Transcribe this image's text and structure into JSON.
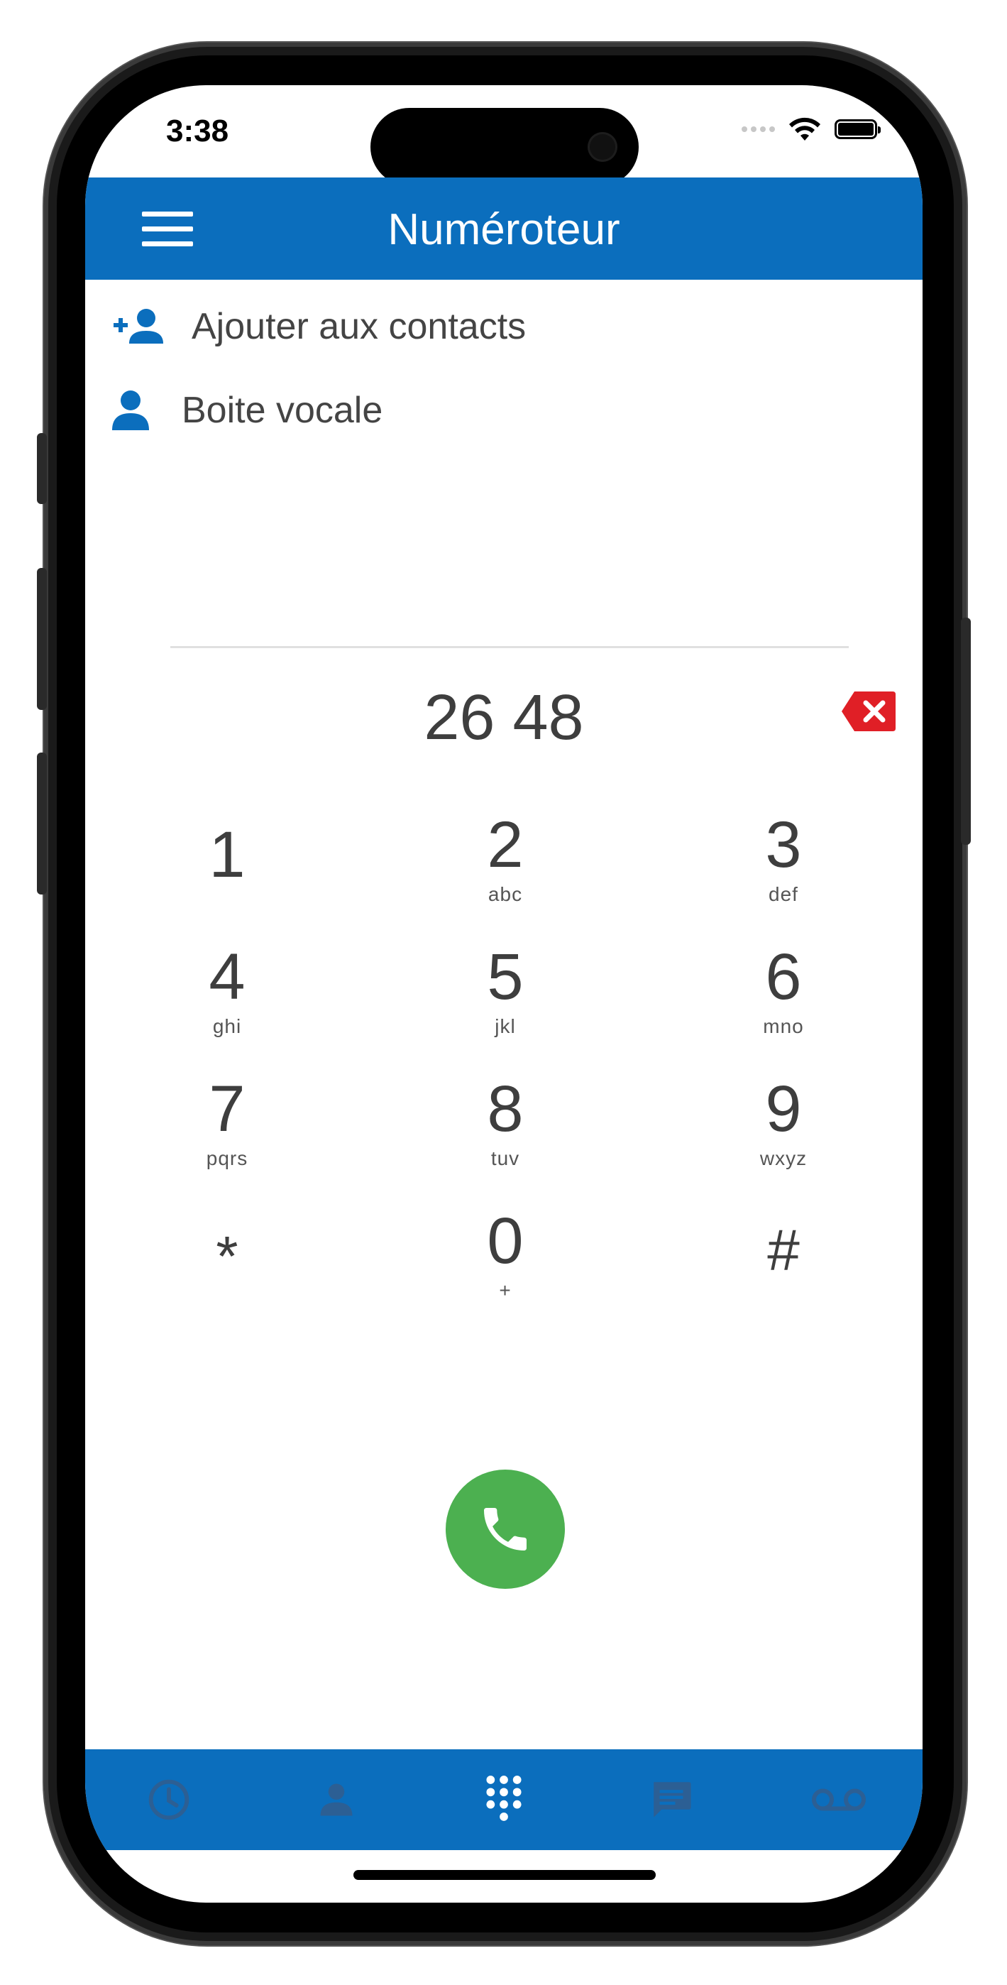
{
  "status_bar": {
    "time": "3:38"
  },
  "header": {
    "title": "Numéroteur",
    "menu_icon": "hamburger-menu-icon"
  },
  "actions": {
    "add_contact_label": "Ajouter aux contacts",
    "voicemail_label": "Boite vocale"
  },
  "dialer": {
    "number": "26 48",
    "keys": [
      {
        "digit": "1",
        "letters": ""
      },
      {
        "digit": "2",
        "letters": "abc"
      },
      {
        "digit": "3",
        "letters": "def"
      },
      {
        "digit": "4",
        "letters": "ghi"
      },
      {
        "digit": "5",
        "letters": "jkl"
      },
      {
        "digit": "6",
        "letters": "mno"
      },
      {
        "digit": "7",
        "letters": "pqrs"
      },
      {
        "digit": "8",
        "letters": "tuv"
      },
      {
        "digit": "9",
        "letters": "wxyz"
      },
      {
        "digit": "*",
        "letters": ""
      },
      {
        "digit": "0",
        "letters": "+"
      },
      {
        "digit": "#",
        "letters": ""
      }
    ]
  },
  "tabbar": {
    "tabs": [
      {
        "icon": "clock-history-icon",
        "active": false
      },
      {
        "icon": "person-contacts-icon",
        "active": false
      },
      {
        "icon": "dialpad-icon",
        "active": true
      },
      {
        "icon": "chat-message-icon",
        "active": false
      },
      {
        "icon": "voicemail-icon",
        "active": false
      }
    ]
  },
  "colors": {
    "brand_blue": "#0b6ebd",
    "call_green": "#4cb050",
    "delete_red": "#e01f26",
    "tab_inactive": "#2c5f94"
  }
}
